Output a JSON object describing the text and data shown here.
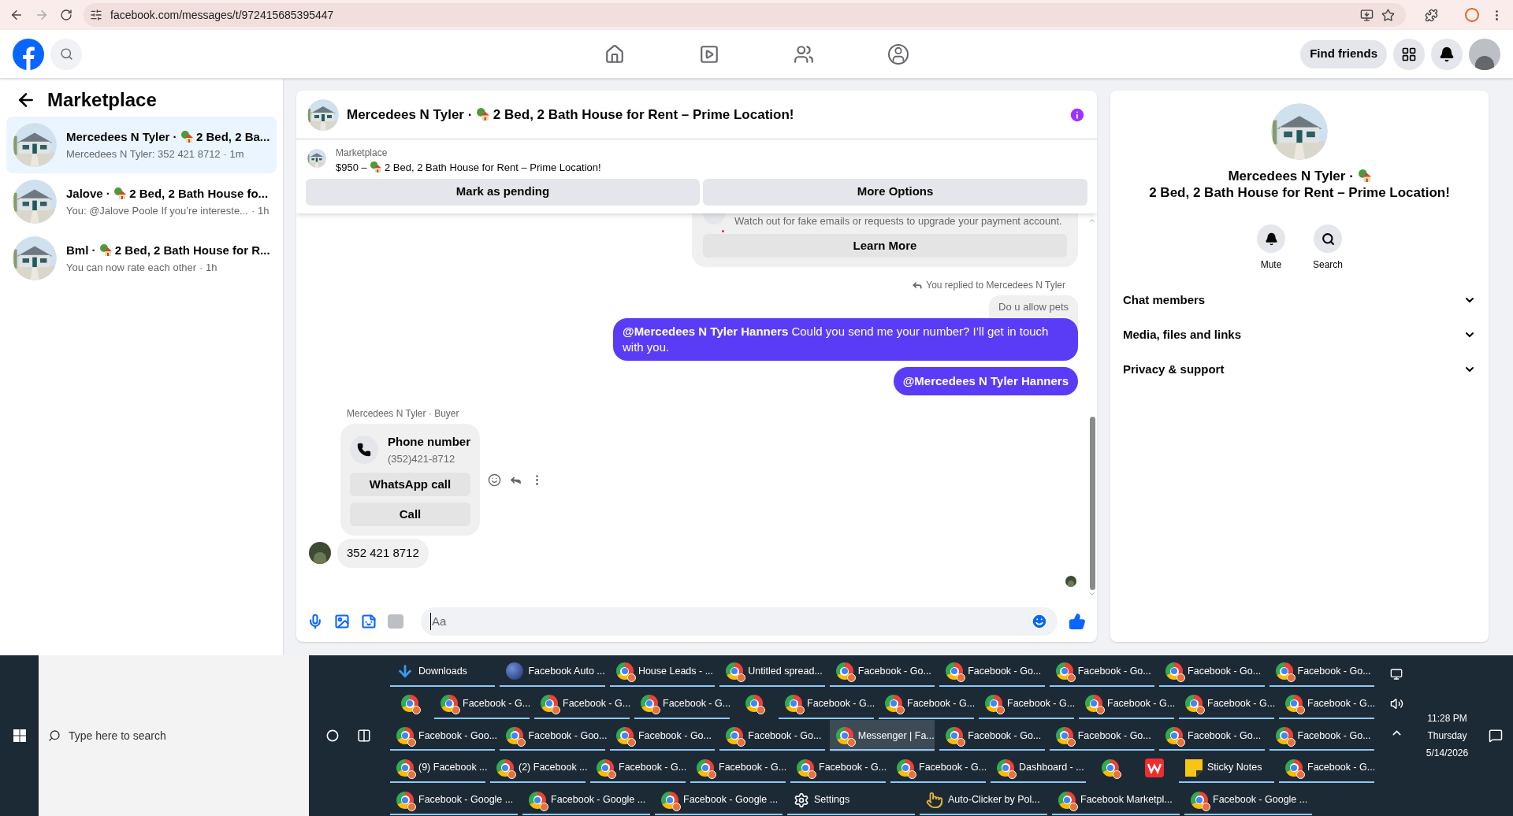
{
  "browser": {
    "url": "facebook.com/messages/t/972415685395447"
  },
  "topbar": {
    "find_friends": "Find friends"
  },
  "sidebar": {
    "title": "Marketplace",
    "conversations": [
      {
        "name": "Mercedees N Tyler ·",
        "listing": "2 Bed, 2 Ba...",
        "preview": "Mercedees N Tyler: 352 421 8712",
        "time": "· 1m",
        "selected": true
      },
      {
        "name": "Jalove ·",
        "listing": "2 Bed, 2 Bath House fo...",
        "preview": "You: @Jalove Poole If you’re intereste...",
        "time": "· 1h",
        "selected": false
      },
      {
        "name": "Bml ·",
        "listing": "2 Bed, 2 Bath House for R...",
        "preview": "You can now rate each other",
        "time": "· 1h",
        "selected": false
      }
    ]
  },
  "chat": {
    "name": "Mercedees N Tyler ·",
    "listing": "2 Bed, 2 Bath House for Rent – Prime Location!",
    "product": {
      "source": "Marketplace",
      "price": "$950 –",
      "listing": "2 Bed, 2 Bath House for Rent – Prime Location!",
      "actions": [
        "Mark as pending",
        "More Options"
      ]
    },
    "warning": {
      "text": "Watch out for fake emails or requests to upgrade your payment account.",
      "action": "Learn More"
    },
    "messages": [
      {
        "kind": "reply_note",
        "text": "You replied to Mercedees N Tyler"
      },
      {
        "kind": "quoted",
        "text": "Do u allow pets"
      },
      {
        "kind": "outgoing",
        "text": "**@Mercedees N Tyler Hanners** Could you send me your number? I’ll get in touch with you."
      },
      {
        "kind": "outgoing_bold",
        "text": "@Mercedees N Tyler Hanners"
      },
      {
        "kind": "sender",
        "text": "Mercedees N Tyler · Buyer"
      },
      {
        "kind": "contact_card",
        "title": "Phone number",
        "number": "(352)421-8712",
        "actions": [
          "WhatsApp call",
          "Call"
        ]
      },
      {
        "kind": "incoming",
        "text": "352 421 8712"
      }
    ],
    "composer": {
      "placeholder": "Aa"
    }
  },
  "details": {
    "name": "Mercedees N Tyler ·",
    "listing": "2 Bed, 2 Bath House for Rent – Prime Location!",
    "actions": [
      {
        "kind": "mute",
        "label": "Mute"
      },
      {
        "kind": "search",
        "label": "Search"
      }
    ],
    "sections": [
      {
        "label": "Chat members",
        "expanded": false
      },
      {
        "label": "Media, files and links",
        "expanded": false
      },
      {
        "label": "Privacy & support",
        "expanded": false
      }
    ]
  },
  "taskbar": {
    "search_placeholder": "Type here to search",
    "time": "11:28 PM",
    "day": "Thursday",
    "date": "5/14/2026",
    "rows": [
      {
        "items": [
          {
            "kind": "download",
            "label": "Downloads",
            "running": true,
            "selected": false
          },
          {
            "kind": "globe",
            "label": "Facebook Auto ...",
            "running": true,
            "selected": false
          },
          {
            "kind": "chrome",
            "label": "House Leads - ...",
            "running": true,
            "selected": false
          },
          {
            "kind": "chrome",
            "label": "Untitled spread...",
            "running": true,
            "selected": false
          },
          {
            "kind": "chrome",
            "label": "Facebook - Go...",
            "running": true,
            "selected": false
          },
          {
            "kind": "chrome",
            "label": "Facebook - Go...",
            "running": true,
            "selected": false
          },
          {
            "kind": "chrome",
            "label": "Facebook - Go...",
            "running": true,
            "selected": false
          },
          {
            "kind": "chrome",
            "label": "Facebook - Go...",
            "running": true,
            "selected": false
          },
          {
            "kind": "chrome",
            "label": "Facebook - Go...",
            "running": true,
            "selected": false
          }
        ]
      },
      {
        "items": [
          {
            "kind": "chrome",
            "running": false,
            "selected": false
          },
          {
            "kind": "chrome",
            "label": "Facebook - G...",
            "running": true,
            "selected": false
          },
          {
            "kind": "chrome",
            "label": "Facebook - G...",
            "running": true,
            "selected": false
          },
          {
            "kind": "chrome",
            "label": "Facebook - G...",
            "running": true,
            "selected": false
          },
          {
            "kind": "chrome",
            "running": false,
            "selected": false
          },
          {
            "kind": "chrome",
            "label": "Facebook - G...",
            "running": true,
            "selected": false
          },
          {
            "kind": "chrome",
            "label": "Facebook - G...",
            "running": true,
            "selected": false
          },
          {
            "kind": "chrome",
            "label": "Facebook - G...",
            "running": true,
            "selected": false
          },
          {
            "kind": "chrome",
            "label": "Facebook - G...",
            "running": true,
            "selected": false
          },
          {
            "kind": "chrome",
            "label": "Facebook - G...",
            "running": true,
            "selected": false
          },
          {
            "kind": "chrome",
            "label": "Facebook - G...",
            "running": true,
            "selected": false
          }
        ]
      },
      {
        "items": [
          {
            "kind": "chrome",
            "label": "Facebook - Goo...",
            "running": true,
            "selected": false
          },
          {
            "kind": "chrome",
            "label": "Facebook - Goo...",
            "running": true,
            "selected": false
          },
          {
            "kind": "chrome",
            "label": "Facebook - Go...",
            "running": true,
            "selected": false
          },
          {
            "kind": "chrome",
            "label": "Facebook - Go...",
            "running": true,
            "selected": false
          },
          {
            "kind": "chrome",
            "label": "Messenger | Fa...",
            "running": true,
            "selected": true
          },
          {
            "kind": "chrome",
            "label": "Facebook - Go...",
            "running": true,
            "selected": false
          },
          {
            "kind": "chrome",
            "label": "Facebook - Go...",
            "running": true,
            "selected": false
          },
          {
            "kind": "chrome",
            "label": "Facebook - Go...",
            "running": true,
            "selected": false
          },
          {
            "kind": "chrome",
            "label": "Facebook - Go...",
            "running": true,
            "selected": false
          }
        ]
      },
      {
        "items": [
          {
            "kind": "chrome",
            "label": "(9) Facebook ...",
            "running": true,
            "selected": false
          },
          {
            "kind": "chrome",
            "label": "(2) Facebook ...",
            "running": true,
            "selected": false
          },
          {
            "kind": "chrome",
            "label": "Facebook - G...",
            "running": true,
            "selected": false
          },
          {
            "kind": "chrome",
            "label": "Facebook - G...",
            "running": true,
            "selected": false
          },
          {
            "kind": "chrome",
            "label": "Facebook - G...",
            "running": true,
            "selected": false
          },
          {
            "kind": "chrome",
            "label": "Facebook - G...",
            "running": true,
            "selected": false
          },
          {
            "kind": "chrome",
            "label": "Dashboard - ...",
            "running": true,
            "selected": false
          },
          {
            "kind": "chrome",
            "running": false,
            "selected": false
          },
          {
            "kind": "wps",
            "running": false,
            "selected": false
          },
          {
            "kind": "sticky",
            "label": "Sticky Notes",
            "running": true,
            "selected": false
          },
          {
            "kind": "chrome",
            "label": "Facebook - G...",
            "running": true,
            "selected": false
          }
        ]
      },
      {
        "items": [
          {
            "kind": "chrome",
            "label": "Facebook - Google ...",
            "running": true,
            "selected": false
          },
          {
            "kind": "chrome",
            "label": "Facebook - Google ...",
            "running": true,
            "selected": false
          },
          {
            "kind": "chrome",
            "label": "Facebook - Google ...",
            "running": true,
            "selected": false
          },
          {
            "kind": "gear",
            "label": "Settings",
            "running": true,
            "selected": false
          },
          {
            "kind": "hand",
            "label": "Auto-Clicker by Pol...",
            "running": true,
            "selected": false
          },
          {
            "kind": "chrome",
            "label": "Facebook Marketpl...",
            "running": true,
            "selected": false
          },
          {
            "kind": "chrome",
            "label": "Facebook - Google ...",
            "running": true,
            "selected": false
          }
        ]
      }
    ]
  }
}
